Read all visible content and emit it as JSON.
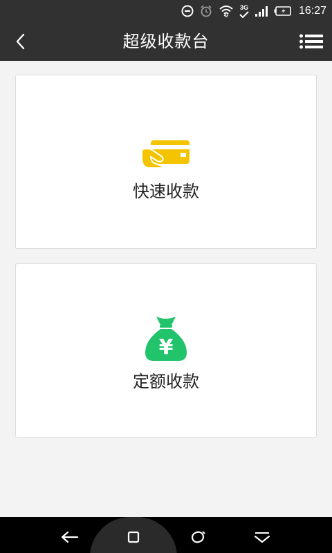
{
  "status_bar": {
    "time": "16:27",
    "network_label": "3G",
    "icons": [
      "do-not-disturb-icon",
      "alarm-icon",
      "wifi-icon",
      "3g-signal-icon",
      "cell-signal-icon",
      "battery-charging-icon"
    ]
  },
  "header": {
    "title": "超级收款台",
    "back_icon": "chevron-left-icon",
    "menu_icon": "list-menu-icon"
  },
  "cards": [
    {
      "label": "快速收款",
      "icon": "card-payment-icon",
      "icon_color": "#f5c400"
    },
    {
      "label": "定额收款",
      "icon": "money-bag-icon",
      "icon_color": "#21c36b",
      "icon_symbol": "¥"
    }
  ],
  "nav_bar": {
    "icons": [
      "back-arrow-icon",
      "home-square-icon",
      "recents-icon",
      "chevron-down-icon"
    ]
  }
}
